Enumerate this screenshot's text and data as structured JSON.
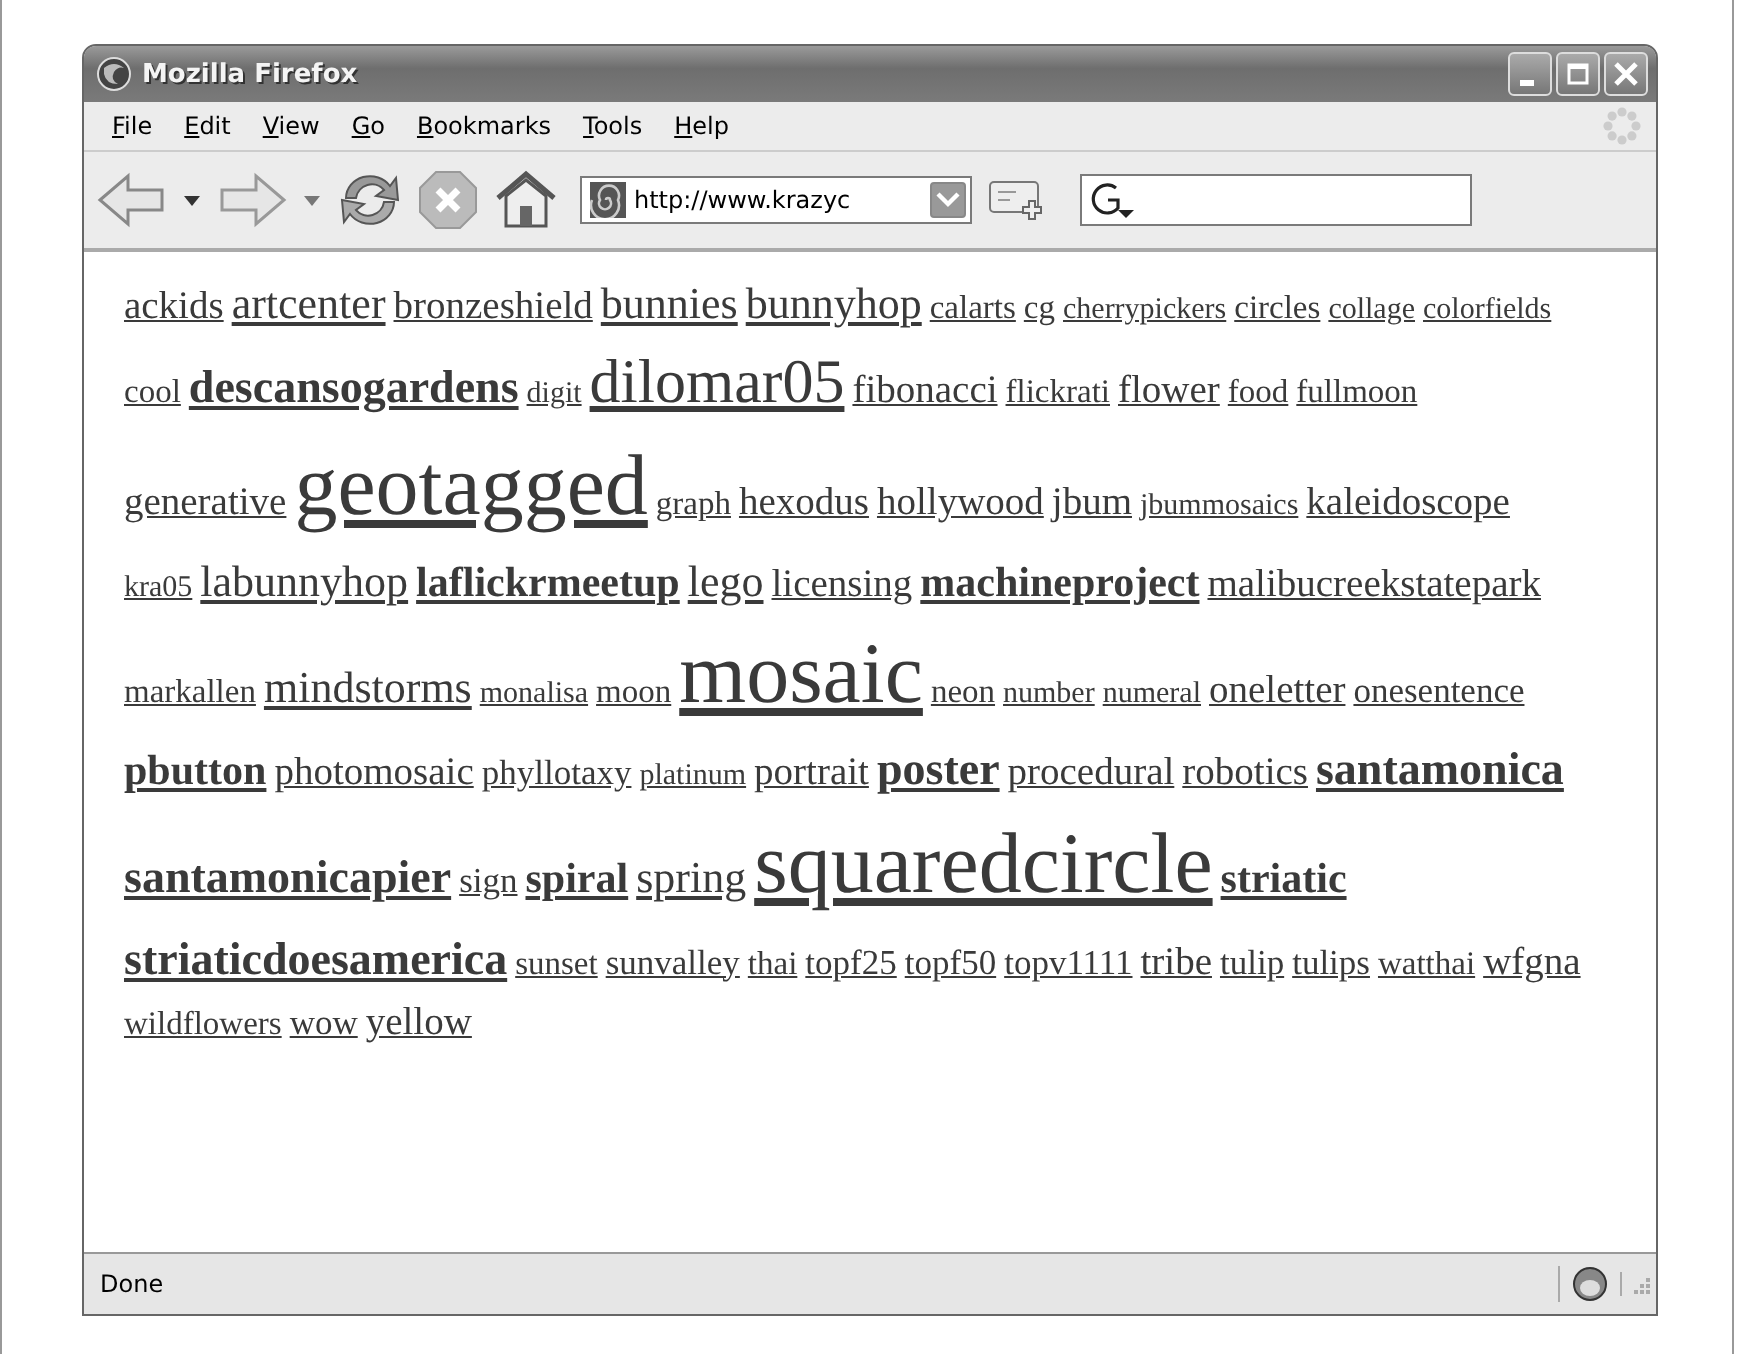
{
  "window": {
    "title": "Mozilla Firefox"
  },
  "menu": [
    {
      "key": "F",
      "rest": "ile"
    },
    {
      "key": "E",
      "rest": "dit"
    },
    {
      "key": "V",
      "rest": "iew"
    },
    {
      "key": "G",
      "rest": "o"
    },
    {
      "key": "B",
      "rest": "ookmarks"
    },
    {
      "key": "T",
      "rest": "ools"
    },
    {
      "key": "H",
      "rest": "elp"
    }
  ],
  "address": {
    "value": "http://www.krazyc"
  },
  "tags": [
    {
      "text": "ackids",
      "kind": "big"
    },
    {
      "text": "artcenter",
      "kind": "bigger"
    },
    {
      "text": "bronzeshield",
      "kind": "big"
    },
    {
      "text": "bunnies",
      "kind": "bigger"
    },
    {
      "text": "bunnyhop",
      "kind": "bigger"
    },
    {
      "text": "calarts",
      "kind": "small"
    },
    {
      "text": "cg",
      "kind": "small"
    },
    {
      "text": "cherrypickers",
      "kind": "tiny"
    },
    {
      "text": "circles",
      "kind": "small"
    },
    {
      "text": "collage",
      "kind": "tiny"
    },
    {
      "text": "colorfields",
      "kind": "tiny"
    },
    {
      "text": "cool",
      "kind": "small"
    },
    {
      "text": "descansogardens",
      "kind": "boldbig"
    },
    {
      "text": "digit",
      "kind": "tiny"
    },
    {
      "text": "dilomar05",
      "kind": "large"
    },
    {
      "text": "fibonacci",
      "kind": "big"
    },
    {
      "text": "flickrati",
      "kind": "small"
    },
    {
      "text": "flower",
      "kind": "big"
    },
    {
      "text": "food",
      "kind": "small"
    },
    {
      "text": "fullmoon",
      "kind": "small"
    },
    {
      "text": "generative",
      "kind": "big"
    },
    {
      "text": "geotagged",
      "kind": "huge"
    },
    {
      "text": "graph",
      "kind": "small"
    },
    {
      "text": "hexodus",
      "kind": "big"
    },
    {
      "text": "hollywood",
      "kind": "big"
    },
    {
      "text": "jbum",
      "kind": "big"
    },
    {
      "text": "jbummosaics",
      "kind": "tiny"
    },
    {
      "text": "kaleidoscope",
      "kind": "big"
    },
    {
      "text": "kra05",
      "kind": "tiny"
    },
    {
      "text": "labunnyhop",
      "kind": "bigger"
    },
    {
      "text": "laflickrmeetup",
      "kind": "bold"
    },
    {
      "text": "lego",
      "kind": "bigger"
    },
    {
      "text": "licensing",
      "kind": "big"
    },
    {
      "text": "machineproject",
      "kind": "bold"
    },
    {
      "text": "malibucreekstatepark",
      "kind": "big"
    },
    {
      "text": "markallen",
      "kind": "small"
    },
    {
      "text": "mindstorms",
      "kind": "bigger"
    },
    {
      "text": "monalisa",
      "kind": "tiny"
    },
    {
      "text": "moon",
      "kind": "small"
    },
    {
      "text": "mosaic",
      "kind": "huge"
    },
    {
      "text": "neon",
      "kind": "small"
    },
    {
      "text": "number",
      "kind": "tiny"
    },
    {
      "text": "numeral",
      "kind": "tiny"
    },
    {
      "text": "oneletter",
      "kind": "big"
    },
    {
      "text": "onesentence",
      "kind": "normal"
    },
    {
      "text": "pbutton",
      "kind": "bold"
    },
    {
      "text": "photomosaic",
      "kind": "big"
    },
    {
      "text": "phyllotaxy",
      "kind": "normal"
    },
    {
      "text": "platinum",
      "kind": "tiny"
    },
    {
      "text": "portrait",
      "kind": "big"
    },
    {
      "text": "poster",
      "kind": "boldbig"
    },
    {
      "text": "procedural",
      "kind": "big"
    },
    {
      "text": "robotics",
      "kind": "big"
    },
    {
      "text": "santamonica",
      "kind": "boldbig"
    },
    {
      "text": "santamonicapier",
      "kind": "boldbig"
    },
    {
      "text": "sign",
      "kind": "normal"
    },
    {
      "text": "spiral",
      "kind": "bold"
    },
    {
      "text": "spring",
      "kind": "bigger"
    },
    {
      "text": "squaredcircle",
      "kind": "huge"
    },
    {
      "text": "striatic",
      "kind": "bold"
    },
    {
      "text": "striaticdoesamerica",
      "kind": "boldbig"
    },
    {
      "text": "sunset",
      "kind": "small"
    },
    {
      "text": "sunvalley",
      "kind": "normal"
    },
    {
      "text": "thai",
      "kind": "small"
    },
    {
      "text": "topf25",
      "kind": "normal"
    },
    {
      "text": "topf50",
      "kind": "normal"
    },
    {
      "text": "topv1111",
      "kind": "normal"
    },
    {
      "text": "tribe",
      "kind": "big"
    },
    {
      "text": "tulip",
      "kind": "normal"
    },
    {
      "text": "tulips",
      "kind": "normal"
    },
    {
      "text": "watthai",
      "kind": "small"
    },
    {
      "text": "wfgna",
      "kind": "big"
    },
    {
      "text": "wildflowers",
      "kind": "small"
    },
    {
      "text": "wow",
      "kind": "normal"
    },
    {
      "text": "yellow",
      "kind": "big"
    }
  ],
  "status_bar": {
    "text": "Done"
  }
}
